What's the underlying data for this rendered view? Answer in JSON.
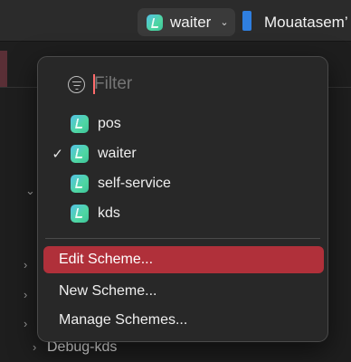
{
  "toolbar": {
    "scheme": {
      "name": "waiter",
      "chevron": "⌄",
      "icon": "app-icon"
    },
    "destination": {
      "label": "Mouatasem’"
    }
  },
  "background": {
    "debug_label": "Debug-kds"
  },
  "menu": {
    "filter": {
      "placeholder": "Filter",
      "value": ""
    },
    "schemes": [
      {
        "label": "pos",
        "checked": false
      },
      {
        "label": "waiter",
        "checked": true
      },
      {
        "label": "self-service",
        "checked": false
      },
      {
        "label": "kds",
        "checked": false
      }
    ],
    "checkmark": "✓",
    "actions": [
      {
        "label": "Edit Scheme...",
        "highlighted": true
      },
      {
        "label": "New Scheme...",
        "highlighted": false
      },
      {
        "label": "Manage Schemes...",
        "highlighted": false
      }
    ]
  },
  "colors": {
    "highlight": "#b0303a",
    "app_icon_gradient": [
      "#54c1e6",
      "#3cc39a"
    ],
    "device_blue": "#2f7fe0"
  }
}
